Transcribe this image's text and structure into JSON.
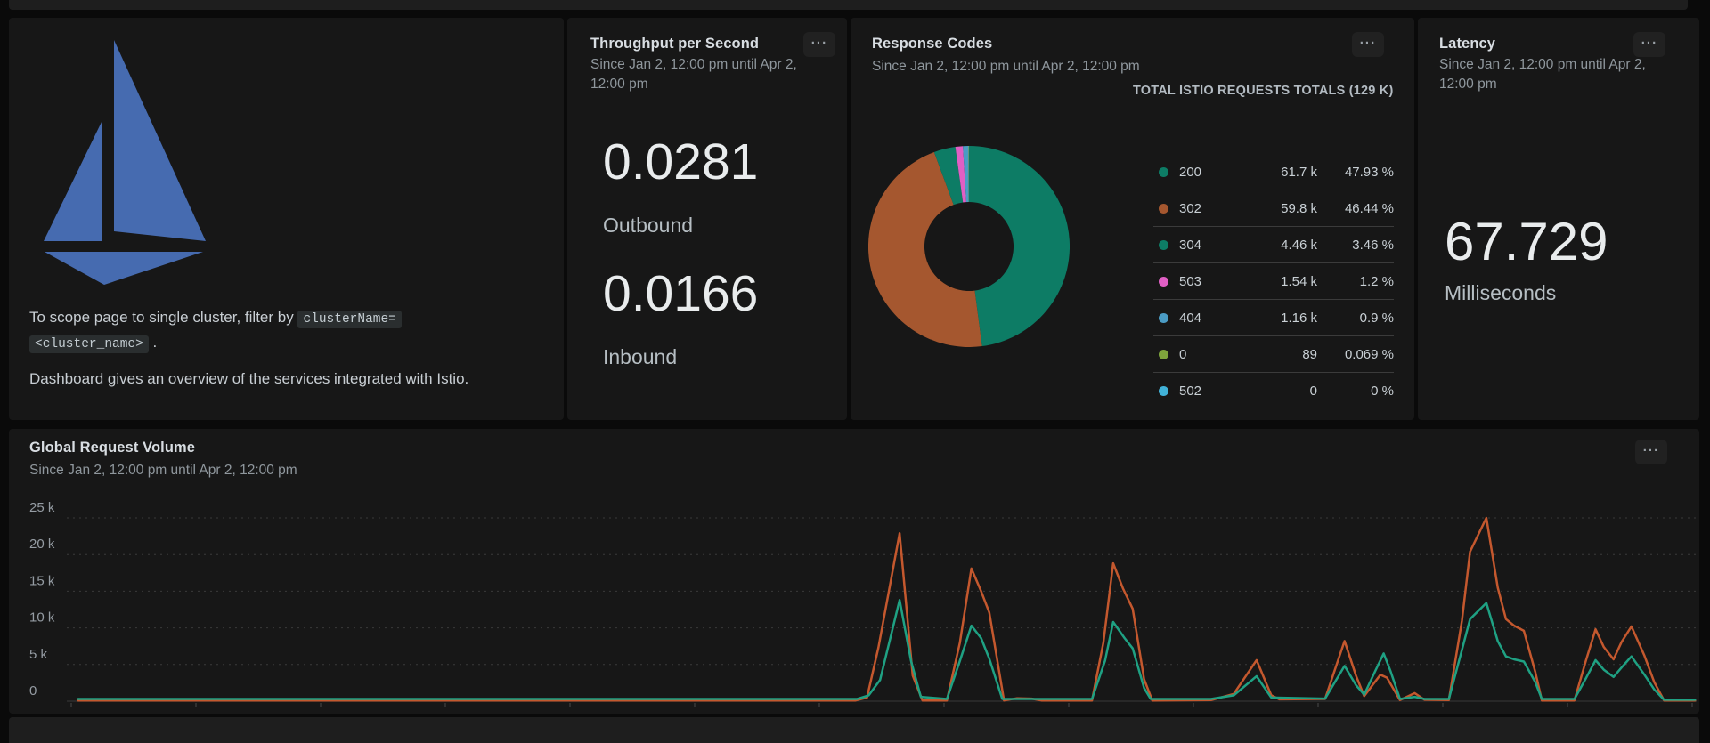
{
  "page": {
    "bg": "#0a0a0a",
    "panel_bg": "#171717",
    "strip_bg": "#1e1e1e"
  },
  "panels": {
    "istio_info": {
      "logo_color": "#466bb0",
      "scope_text_prefix": "To scope page to single cluster, filter by ",
      "scope_code_1": "clusterName=",
      "scope_code_2": "<cluster_name>",
      "scope_text_suffix": " .",
      "description": "Dashboard gives an overview of the services integrated with Istio."
    },
    "throughput": {
      "title": "Throughput per Second",
      "subtitle": "Since Jan 2, 12:00 pm until Apr 2, 12:00 pm",
      "menu_label": "...",
      "outbound_value": "0.0281",
      "outbound_label": "Outbound",
      "inbound_value": "0.0166",
      "inbound_label": "Inbound"
    },
    "response_codes": {
      "title": "Response Codes",
      "subtitle": "Since Jan 2, 12:00 pm until Apr 2, 12:00 pm",
      "menu_label": "...",
      "table_title": "TOTAL ISTIO REQUESTS TOTALS (129 K)"
    },
    "latency": {
      "title": "Latency",
      "subtitle": "Since Jan 2, 12:00 pm until Apr 2, 12:00 pm",
      "menu_label": "...",
      "value": "67.729",
      "unit": "Milliseconds"
    },
    "global_request_volume": {
      "title": "Global Request Volume",
      "subtitle": "Since Jan 2, 12:00 pm until Apr 2, 12:00 pm",
      "menu_label": "..."
    }
  },
  "chart_data": [
    {
      "type": "pie",
      "donut": true,
      "title": "Response Codes",
      "legend_title": "TOTAL ISTIO REQUESTS TOTALS (129 K)",
      "legend_position": "right",
      "series": [
        {
          "label": "200",
          "count": "61.7 k",
          "pct": 47.93,
          "pct_label": "47.93 %",
          "color": "#0d7c65"
        },
        {
          "label": "302",
          "count": "59.8 k",
          "pct": 46.44,
          "pct_label": "46.44 %",
          "color": "#a5572f"
        },
        {
          "label": "304",
          "count": "4.46 k",
          "pct": 3.46,
          "pct_label": "3.46 %",
          "color": "#0d7c65"
        },
        {
          "label": "503",
          "count": "1.54 k",
          "pct": 1.2,
          "pct_label": "1.2 %",
          "color": "#e05fc4"
        },
        {
          "label": "404",
          "count": "1.16 k",
          "pct": 0.9,
          "pct_label": "0.9 %",
          "color": "#4b9cc4"
        },
        {
          "label": "0",
          "count": "89",
          "pct": 0.069,
          "pct_label": "0.069 %",
          "color": "#7ea43c"
        },
        {
          "label": "502",
          "count": "0",
          "pct": 0,
          "pct_label": "0 %",
          "color": "#41b2d8"
        }
      ]
    },
    {
      "type": "line",
      "title": "Global Request Volume",
      "xlabel": "",
      "ylabel": "",
      "ylim": [
        0,
        25
      ],
      "grid": "dashed-horizontal",
      "legend": "none",
      "yticks": [
        {
          "label": "25 k",
          "value": 25
        },
        {
          "label": "20 k",
          "value": 20
        },
        {
          "label": "15 k",
          "value": 15
        },
        {
          "label": "10 k",
          "value": 10
        },
        {
          "label": "5 k",
          "value": 5
        },
        {
          "label": "0",
          "value": 0
        }
      ],
      "x_tick_count": 14,
      "unit": "k requests",
      "series": [
        {
          "name": "series-orange",
          "color": "#c4582e",
          "points": [
            [
              0.007,
              0.1
            ],
            [
              0.484,
              0.1
            ],
            [
              0.491,
              0.5
            ],
            [
              0.498,
              7.3
            ],
            [
              0.511,
              22.9
            ],
            [
              0.519,
              3.5
            ],
            [
              0.525,
              0.1
            ],
            [
              0.54,
              0.1
            ],
            [
              0.548,
              8.0
            ],
            [
              0.555,
              18.1
            ],
            [
              0.561,
              15.0
            ],
            [
              0.566,
              12.1
            ],
            [
              0.575,
              0.1
            ],
            [
              0.583,
              0.4
            ],
            [
              0.592,
              0.35
            ],
            [
              0.598,
              0.1
            ],
            [
              0.629,
              0.1
            ],
            [
              0.636,
              8.0
            ],
            [
              0.642,
              18.8
            ],
            [
              0.648,
              15.4
            ],
            [
              0.654,
              12.6
            ],
            [
              0.661,
              3.0
            ],
            [
              0.666,
              0.1
            ],
            [
              0.702,
              0.15
            ],
            [
              0.716,
              1.0
            ],
            [
              0.73,
              5.6
            ],
            [
              0.739,
              0.8
            ],
            [
              0.744,
              0.25
            ],
            [
              0.772,
              0.3
            ],
            [
              0.784,
              8.2
            ],
            [
              0.791,
              3.5
            ],
            [
              0.796,
              0.7
            ],
            [
              0.806,
              3.6
            ],
            [
              0.81,
              3.2
            ],
            [
              0.818,
              0.15
            ],
            [
              0.827,
              1.1
            ],
            [
              0.833,
              0.2
            ],
            [
              0.848,
              0.15
            ],
            [
              0.856,
              11.0
            ],
            [
              0.861,
              20.4
            ],
            [
              0.871,
              25.0
            ],
            [
              0.878,
              15.5
            ],
            [
              0.883,
              11.2
            ],
            [
              0.888,
              10.3
            ],
            [
              0.894,
              9.6
            ],
            [
              0.901,
              4.0
            ],
            [
              0.905,
              0.1
            ],
            [
              0.925,
              0.1
            ],
            [
              0.932,
              5.5
            ],
            [
              0.938,
              9.8
            ],
            [
              0.943,
              7.4
            ],
            [
              0.949,
              5.7
            ],
            [
              0.954,
              8.1
            ],
            [
              0.96,
              10.2
            ],
            [
              0.968,
              6.2
            ],
            [
              0.974,
              2.6
            ],
            [
              0.98,
              0.1
            ],
            [
              0.999,
              0.1
            ]
          ]
        },
        {
          "name": "series-teal",
          "color": "#1fa183",
          "points": [
            [
              0.007,
              0.3
            ],
            [
              0.485,
              0.3
            ],
            [
              0.492,
              0.8
            ],
            [
              0.499,
              2.9
            ],
            [
              0.511,
              13.8
            ],
            [
              0.518,
              5.5
            ],
            [
              0.524,
              0.6
            ],
            [
              0.54,
              0.3
            ],
            [
              0.548,
              5.5
            ],
            [
              0.555,
              10.3
            ],
            [
              0.561,
              8.6
            ],
            [
              0.566,
              5.8
            ],
            [
              0.574,
              0.3
            ],
            [
              0.629,
              0.3
            ],
            [
              0.637,
              5.5
            ],
            [
              0.642,
              10.8
            ],
            [
              0.649,
              8.6
            ],
            [
              0.654,
              7.2
            ],
            [
              0.661,
              1.8
            ],
            [
              0.665,
              0.3
            ],
            [
              0.702,
              0.3
            ],
            [
              0.716,
              0.8
            ],
            [
              0.73,
              3.4
            ],
            [
              0.739,
              0.5
            ],
            [
              0.772,
              0.35
            ],
            [
              0.784,
              4.8
            ],
            [
              0.791,
              2.2
            ],
            [
              0.796,
              0.9
            ],
            [
              0.803,
              4.2
            ],
            [
              0.808,
              6.5
            ],
            [
              0.812,
              4.2
            ],
            [
              0.818,
              0.3
            ],
            [
              0.827,
              0.6
            ],
            [
              0.833,
              0.3
            ],
            [
              0.848,
              0.3
            ],
            [
              0.856,
              7.0
            ],
            [
              0.861,
              11.2
            ],
            [
              0.871,
              13.4
            ],
            [
              0.878,
              8.2
            ],
            [
              0.883,
              6.1
            ],
            [
              0.888,
              5.7
            ],
            [
              0.894,
              5.4
            ],
            [
              0.901,
              2.6
            ],
            [
              0.905,
              0.3
            ],
            [
              0.925,
              0.3
            ],
            [
              0.932,
              3.1
            ],
            [
              0.938,
              5.6
            ],
            [
              0.943,
              4.3
            ],
            [
              0.949,
              3.3
            ],
            [
              0.954,
              4.6
            ],
            [
              0.96,
              6.1
            ],
            [
              0.968,
              3.6
            ],
            [
              0.974,
              1.6
            ],
            [
              0.98,
              0.2
            ],
            [
              0.999,
              0.2
            ]
          ]
        }
      ]
    }
  ]
}
